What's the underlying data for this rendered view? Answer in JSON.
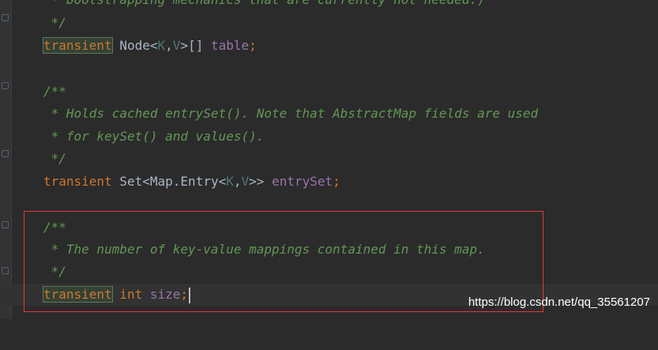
{
  "editor": {
    "lines": [
      {
        "comment": " * bootstrapping mechanics that are currently not needed.)"
      },
      {
        "comment": " */"
      },
      {
        "kw": "transient",
        "type": "Node",
        "lt": "<",
        "k": "K",
        "comma": ",",
        "v": "V",
        "gt": ">",
        "arr": "[]",
        "name": "table",
        "semi": ";"
      },
      {
        "comment": "/**"
      },
      {
        "comment": " * Holds cached entrySet(). Note that AbstractMap fields are used"
      },
      {
        "comment": " * for keySet() and values()."
      },
      {
        "comment": " */"
      },
      {
        "kw": "transient",
        "type": "Set",
        "lt": "<",
        "inner": "Map.Entry",
        "lt2": "<",
        "k": "K",
        "comma": ",",
        "v": "V",
        "gt": ">>",
        "name": "entrySet",
        "semi": ";"
      },
      {
        "comment": "/**"
      },
      {
        "comment": " * The number of key-value mappings contained in this map."
      },
      {
        "comment": " */"
      },
      {
        "kw": "transient",
        "prim": "int",
        "name": "size",
        "semi": ";"
      }
    ]
  },
  "watermark": "https://blog.csdn.net/qq_35561207",
  "colors": {
    "background": "#2b2b2b",
    "comment": "#629755",
    "keyword": "#cc7832",
    "field": "#9876aa",
    "highlight_box": "#e0393b"
  }
}
